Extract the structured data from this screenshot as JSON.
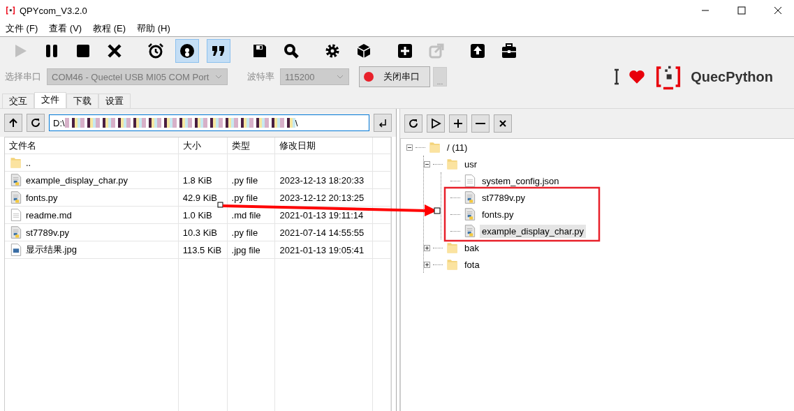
{
  "window": {
    "title": "QPYcom_V3.2.0"
  },
  "menu": [
    "文件 (F)",
    "查看 (V)",
    "教程 (E)",
    "帮助 (H)"
  ],
  "toolbar": [
    {
      "disabled": true,
      "on": false
    },
    {
      "disabled": false,
      "on": false
    },
    {
      "disabled": false,
      "on": false
    },
    {
      "disabled": false,
      "on": false
    },
    {
      "disabled": false,
      "on": false
    },
    {
      "disabled": false,
      "on": true
    },
    {
      "disabled": false,
      "on": true
    },
    {
      "disabled": false,
      "on": false
    },
    {
      "disabled": false,
      "on": false
    },
    {
      "disabled": false,
      "on": false
    },
    {
      "disabled": false,
      "on": false
    },
    {
      "disabled": false,
      "on": false
    },
    {
      "disabled": true,
      "on": false
    },
    {
      "disabled": false,
      "on": false
    },
    {
      "disabled": false,
      "on": false
    }
  ],
  "port": {
    "label": "选择串口",
    "value": "COM46 - Quectel USB MI05 COM Port",
    "disabled": true
  },
  "baud": {
    "label": "波特率",
    "value": "115200",
    "disabled": true
  },
  "connect_button": {
    "label": "关闭串口",
    "connected": true
  },
  "more_button": "...",
  "brand": "QuecPython",
  "tabs": [
    {
      "label": "交互",
      "selected": false
    },
    {
      "label": "文件",
      "selected": true
    },
    {
      "label": "下载",
      "selected": false
    },
    {
      "label": "设置",
      "selected": false
    }
  ],
  "local": {
    "path_start": "D:\\",
    "path_end": "\\",
    "columns": [
      "文件名",
      "大小",
      "类型",
      "修改日期"
    ],
    "rows": [
      {
        "kind": "folder",
        "name": "..",
        "size": "",
        "type": "",
        "modified": ""
      },
      {
        "kind": "py",
        "name": "example_display_char.py",
        "size": "1.8 KiB",
        "type": ".py file",
        "modified": "2023-12-13 18:20:33"
      },
      {
        "kind": "py",
        "name": "fonts.py",
        "size": "42.9 KiB",
        "type": ".py file",
        "modified": "2023-12-12 20:13:25"
      },
      {
        "kind": "text",
        "name": "readme.md",
        "size": "1.0 KiB",
        "type": ".md file",
        "modified": "2021-01-13 19:11:14"
      },
      {
        "kind": "py",
        "name": "st7789v.py",
        "size": "10.3 KiB",
        "type": ".py file",
        "modified": "2021-07-14 14:55:55"
      },
      {
        "kind": "image",
        "name": "显示结果.jpg",
        "size": "113.5 KiB",
        "type": ".jpg file",
        "modified": "2021-01-13 19:05:41"
      }
    ]
  },
  "device": {
    "tree": [
      {
        "kind": "folder",
        "name": "/ (11)",
        "expanded": true,
        "selected": false,
        "children": [
          {
            "kind": "folder",
            "name": "usr",
            "expanded": true,
            "selected": false,
            "children": [
              {
                "kind": "text",
                "name": "system_config.json",
                "selected": false
              },
              {
                "kind": "py",
                "name": "st7789v.py",
                "selected": false
              },
              {
                "kind": "py",
                "name": "fonts.py",
                "selected": false
              },
              {
                "kind": "py",
                "name": "example_display_char.py",
                "selected": true
              }
            ]
          },
          {
            "kind": "folder",
            "name": "bak",
            "expanded": false,
            "selected": false
          },
          {
            "kind": "folder",
            "name": "fota",
            "expanded": false,
            "selected": false
          }
        ]
      }
    ]
  }
}
